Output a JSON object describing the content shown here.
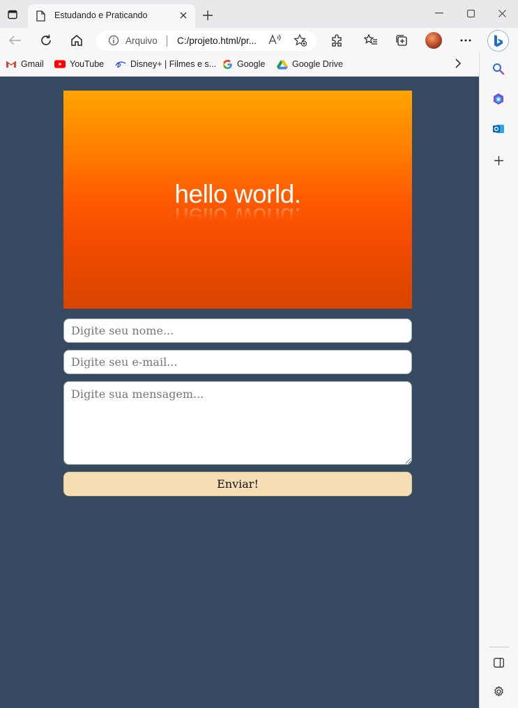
{
  "browser": {
    "tab_title": "Estudando e Praticando",
    "address": {
      "security_label": "Arquivo",
      "url": "C:/projeto.html/pr..."
    },
    "bookmarks": [
      {
        "label": "Gmail",
        "icon": "gmail-icon"
      },
      {
        "label": "YouTube",
        "icon": "youtube-icon"
      },
      {
        "label": "Disney+ | Filmes e s...",
        "icon": "disney-icon"
      },
      {
        "label": "Google",
        "icon": "google-icon"
      },
      {
        "label": "Google Drive",
        "icon": "google-drive-icon"
      }
    ]
  },
  "page": {
    "hero_text": "hello world.",
    "form": {
      "name_placeholder": "Digite seu nome...",
      "email_placeholder": "Digite seu e-mail...",
      "message_placeholder": "Digite sua mensagem...",
      "submit_label": "Enviar!"
    }
  },
  "colors": {
    "page_background": "#354a60",
    "hero_gradient": [
      "#ffa400",
      "#ff5a00",
      "#d84500"
    ],
    "submit_button": "#f5deb3"
  }
}
